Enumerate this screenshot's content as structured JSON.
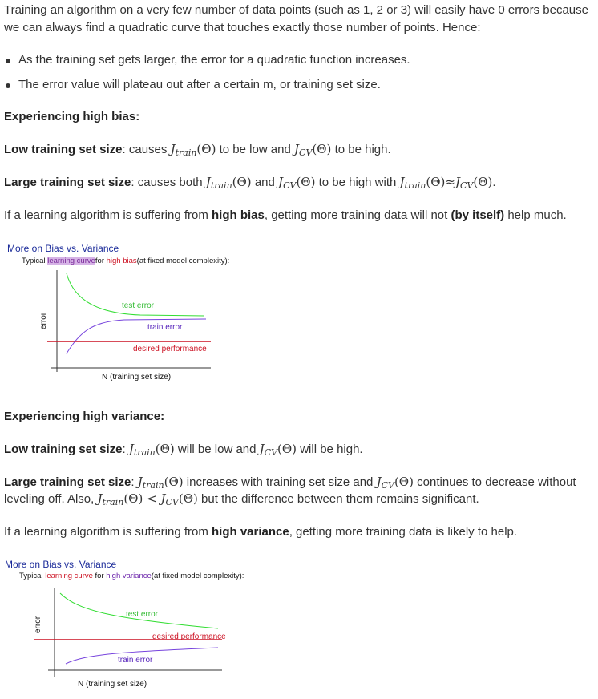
{
  "intro": "Training an algorithm on a very few number of data points (such as 1, 2 or 3) will easily have 0 errors because we can always find a quadratic curve that touches exactly those number of points. Hence:",
  "bullets": [
    "As the training set gets larger, the error for a quadratic function increases.",
    "The error value will plateau out after a certain m, or training set size."
  ],
  "bias": {
    "heading": "Experiencing high bias:",
    "low_label": "Low training set size",
    "low_text_1": ": causes ",
    "low_text_2": " to be low and ",
    "low_text_3": " to be high.",
    "large_label": "Large training set size",
    "large_text_1": ": causes both ",
    "large_text_2": " and ",
    "large_text_3": " to be high with ",
    "large_text_4": ".",
    "summary_1": "If a learning algorithm is suffering from ",
    "summary_b1": "high bias",
    "summary_2": ", getting more training data will not ",
    "summary_b2": "(by itself)",
    "summary_3": " help much."
  },
  "math": {
    "J": "J",
    "train": "train",
    "cv": "CV",
    "theta": "(Θ)",
    "approx": "≈",
    "lt": "<"
  },
  "figure1": {
    "title": "More on Bias vs. Variance",
    "sub_1": "Typical ",
    "sub_hl": "learning curve",
    "sub_2": "for ",
    "sub_red": "high bias",
    "sub_3": "(at fixed model complexity):",
    "ylabel": "error",
    "xlabel": "N (training set size)",
    "test_label": "test error",
    "train_label": "train error",
    "desired_label": "desired performance",
    "colors": {
      "test": "#33dd33",
      "train": "#7744dd",
      "desired": "#cc1122",
      "axis": "#333333"
    }
  },
  "variance": {
    "heading": "Experiencing high variance:",
    "low_label": "Low training set size",
    "low_text_1": ": ",
    "low_text_2": " will be low and ",
    "low_text_3": " will be high.",
    "large_label": "Large training set size",
    "large_text_1": ": ",
    "large_text_2": " increases with training set size and ",
    "large_text_3": " continues to decrease without leveling off. Also, ",
    "large_text_4": " but the difference between them remains significant.",
    "summary_1": "If a learning algorithm is suffering from ",
    "summary_b1": "high variance",
    "summary_2": ", getting more training data is likely to help."
  },
  "figure2": {
    "title": "More on Bias vs. Variance",
    "sub_1": "Typical ",
    "sub_red": "learning curve",
    "sub_2": " for ",
    "sub_pur": "high variance",
    "sub_3": "(at fixed model complexity):",
    "ylabel": "error",
    "xlabel": "N (training set size)",
    "test_label": "test error",
    "train_label": "train error",
    "desired_label": "desired performance",
    "colors": {
      "test": "#33dd33",
      "train": "#7744dd",
      "desired": "#cc1122",
      "axis": "#333333"
    }
  }
}
